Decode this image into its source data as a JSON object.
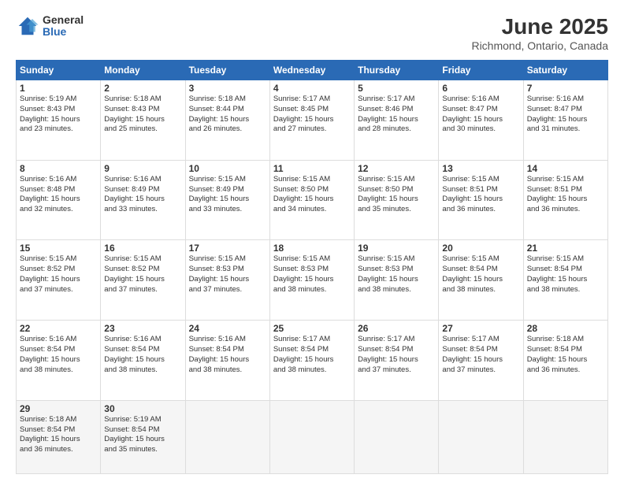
{
  "logo": {
    "general": "General",
    "blue": "Blue"
  },
  "header": {
    "title": "June 2025",
    "subtitle": "Richmond, Ontario, Canada"
  },
  "weekdays": [
    "Sunday",
    "Monday",
    "Tuesday",
    "Wednesday",
    "Thursday",
    "Friday",
    "Saturday"
  ],
  "weeks": [
    [
      {
        "day": "1",
        "sunrise": "5:19 AM",
        "sunset": "8:43 PM",
        "daylight": "15 hours and 23 minutes."
      },
      {
        "day": "2",
        "sunrise": "5:18 AM",
        "sunset": "8:43 PM",
        "daylight": "15 hours and 25 minutes."
      },
      {
        "day": "3",
        "sunrise": "5:18 AM",
        "sunset": "8:44 PM",
        "daylight": "15 hours and 26 minutes."
      },
      {
        "day": "4",
        "sunrise": "5:17 AM",
        "sunset": "8:45 PM",
        "daylight": "15 hours and 27 minutes."
      },
      {
        "day": "5",
        "sunrise": "5:17 AM",
        "sunset": "8:46 PM",
        "daylight": "15 hours and 28 minutes."
      },
      {
        "day": "6",
        "sunrise": "5:16 AM",
        "sunset": "8:47 PM",
        "daylight": "15 hours and 30 minutes."
      },
      {
        "day": "7",
        "sunrise": "5:16 AM",
        "sunset": "8:47 PM",
        "daylight": "15 hours and 31 minutes."
      }
    ],
    [
      {
        "day": "8",
        "sunrise": "5:16 AM",
        "sunset": "8:48 PM",
        "daylight": "15 hours and 32 minutes."
      },
      {
        "day": "9",
        "sunrise": "5:16 AM",
        "sunset": "8:49 PM",
        "daylight": "15 hours and 33 minutes."
      },
      {
        "day": "10",
        "sunrise": "5:15 AM",
        "sunset": "8:49 PM",
        "daylight": "15 hours and 33 minutes."
      },
      {
        "day": "11",
        "sunrise": "5:15 AM",
        "sunset": "8:50 PM",
        "daylight": "15 hours and 34 minutes."
      },
      {
        "day": "12",
        "sunrise": "5:15 AM",
        "sunset": "8:50 PM",
        "daylight": "15 hours and 35 minutes."
      },
      {
        "day": "13",
        "sunrise": "5:15 AM",
        "sunset": "8:51 PM",
        "daylight": "15 hours and 36 minutes."
      },
      {
        "day": "14",
        "sunrise": "5:15 AM",
        "sunset": "8:51 PM",
        "daylight": "15 hours and 36 minutes."
      }
    ],
    [
      {
        "day": "15",
        "sunrise": "5:15 AM",
        "sunset": "8:52 PM",
        "daylight": "15 hours and 37 minutes."
      },
      {
        "day": "16",
        "sunrise": "5:15 AM",
        "sunset": "8:52 PM",
        "daylight": "15 hours and 37 minutes."
      },
      {
        "day": "17",
        "sunrise": "5:15 AM",
        "sunset": "8:53 PM",
        "daylight": "15 hours and 37 minutes."
      },
      {
        "day": "18",
        "sunrise": "5:15 AM",
        "sunset": "8:53 PM",
        "daylight": "15 hours and 38 minutes."
      },
      {
        "day": "19",
        "sunrise": "5:15 AM",
        "sunset": "8:53 PM",
        "daylight": "15 hours and 38 minutes."
      },
      {
        "day": "20",
        "sunrise": "5:15 AM",
        "sunset": "8:54 PM",
        "daylight": "15 hours and 38 minutes."
      },
      {
        "day": "21",
        "sunrise": "5:15 AM",
        "sunset": "8:54 PM",
        "daylight": "15 hours and 38 minutes."
      }
    ],
    [
      {
        "day": "22",
        "sunrise": "5:16 AM",
        "sunset": "8:54 PM",
        "daylight": "15 hours and 38 minutes."
      },
      {
        "day": "23",
        "sunrise": "5:16 AM",
        "sunset": "8:54 PM",
        "daylight": "15 hours and 38 minutes."
      },
      {
        "day": "24",
        "sunrise": "5:16 AM",
        "sunset": "8:54 PM",
        "daylight": "15 hours and 38 minutes."
      },
      {
        "day": "25",
        "sunrise": "5:17 AM",
        "sunset": "8:54 PM",
        "daylight": "15 hours and 38 minutes."
      },
      {
        "day": "26",
        "sunrise": "5:17 AM",
        "sunset": "8:54 PM",
        "daylight": "15 hours and 37 minutes."
      },
      {
        "day": "27",
        "sunrise": "5:17 AM",
        "sunset": "8:54 PM",
        "daylight": "15 hours and 37 minutes."
      },
      {
        "day": "28",
        "sunrise": "5:18 AM",
        "sunset": "8:54 PM",
        "daylight": "15 hours and 36 minutes."
      }
    ],
    [
      {
        "day": "29",
        "sunrise": "5:18 AM",
        "sunset": "8:54 PM",
        "daylight": "15 hours and 36 minutes."
      },
      {
        "day": "30",
        "sunrise": "5:19 AM",
        "sunset": "8:54 PM",
        "daylight": "15 hours and 35 minutes."
      },
      null,
      null,
      null,
      null,
      null
    ]
  ]
}
